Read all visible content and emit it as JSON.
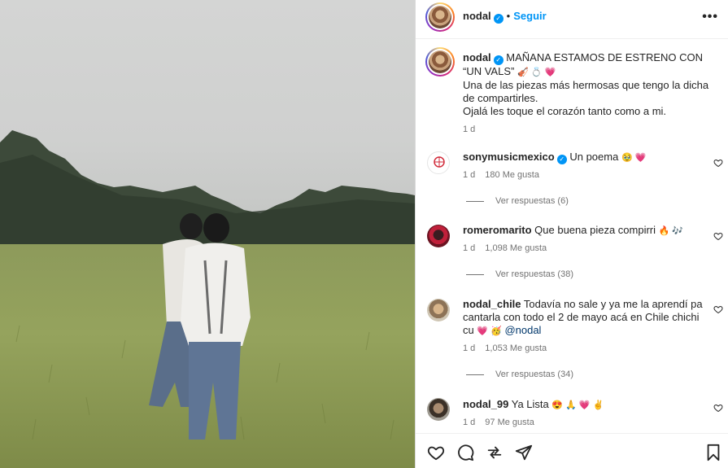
{
  "post": {
    "author": "nodal",
    "follow_label": "Seguir",
    "more_label": "•••",
    "verified_mark": "✓",
    "dot": "•"
  },
  "caption": {
    "username": "nodal",
    "line1": "MAÑANA ESTAMOS DE ESTRENO CON “UN VALS”",
    "emojis": "🎻 💍 💗",
    "line2": "Una de las piezas más hermosas que tengo la dicha de compartirles.",
    "line3": "Ojalá les toque el corazón tanto como a mi.",
    "time": "1 d"
  },
  "comments": [
    {
      "username": "sonymusicmexico",
      "verified": true,
      "text": "Un poema",
      "emojis": "🥹 💗",
      "time": "1 d",
      "likes": "180 Me gusta",
      "replies": "Ver respuestas (6)"
    },
    {
      "username": "romeromarito",
      "verified": false,
      "text": "Que buena pieza compirri",
      "emojis": "🔥 🎶",
      "time": "1 d",
      "likes": "1,098 Me gusta",
      "replies": "Ver respuestas (38)"
    },
    {
      "username": "nodal_chile",
      "verified": false,
      "text": "Todavía no sale y ya me la aprendí pa cantarla con todo el 2 de mayo acá en Chile chichi cu",
      "emojis": "💗 🥳",
      "mention": "@nodal",
      "time": "1 d",
      "likes": "1,053 Me gusta",
      "replies": "Ver respuestas (34)"
    },
    {
      "username": "nodal_99",
      "verified": false,
      "text": "Ya Lista",
      "emojis": "😍 🙏 💗 ✌️",
      "time": "1 d",
      "likes": "97 Me gusta"
    }
  ],
  "colors": {
    "link": "#0095f6",
    "text": "#262626",
    "muted": "#737373",
    "border": "#dbdbdb"
  },
  "icons": [
    "heart-icon",
    "comment-icon",
    "share-icon",
    "send-icon",
    "bookmark-icon",
    "more-icon",
    "verified-icon"
  ]
}
